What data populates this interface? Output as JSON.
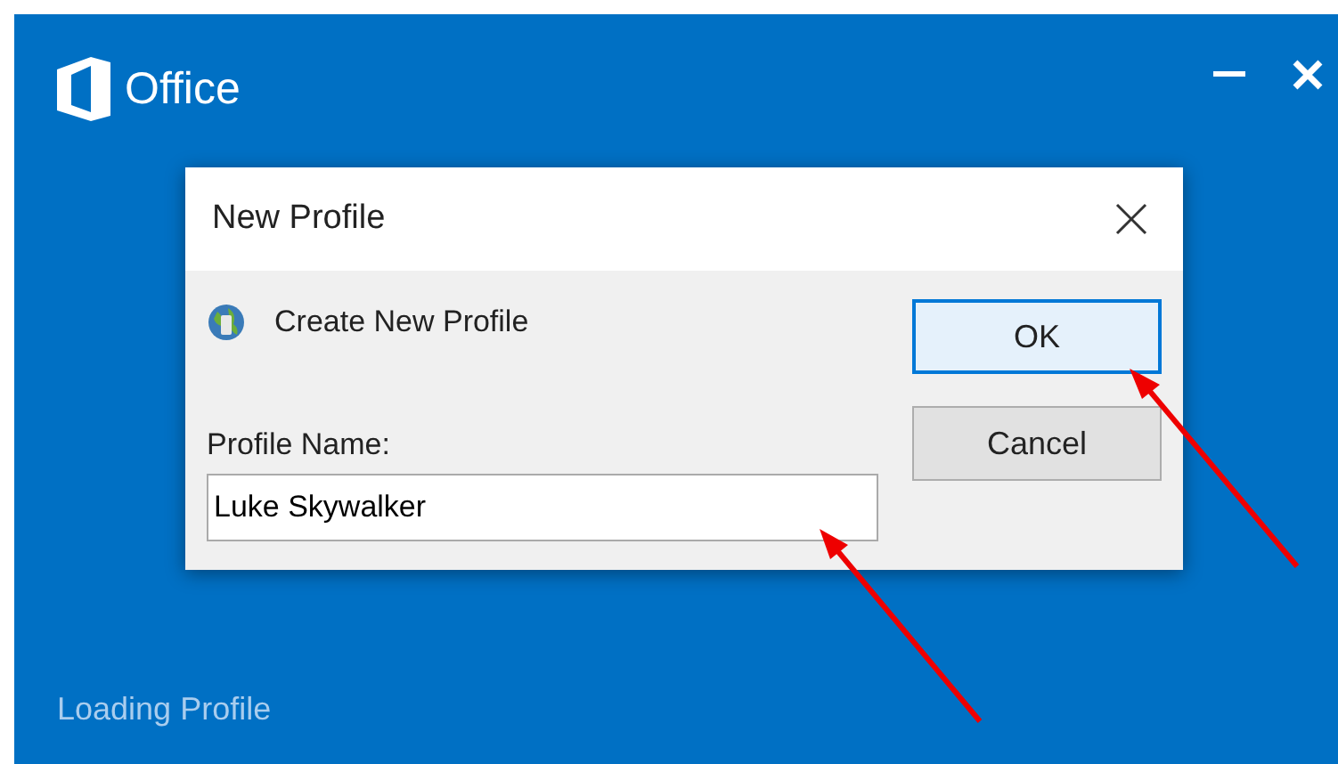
{
  "window": {
    "title": "Office",
    "status": "Loading Profile"
  },
  "dialog": {
    "title": "New Profile",
    "heading": "Create New Profile",
    "field_label": "Profile Name:",
    "field_value": "Luke Skywalker",
    "buttons": [
      {
        "label": "OK",
        "selected": true
      },
      {
        "label": "Cancel",
        "selected": false
      }
    ]
  }
}
